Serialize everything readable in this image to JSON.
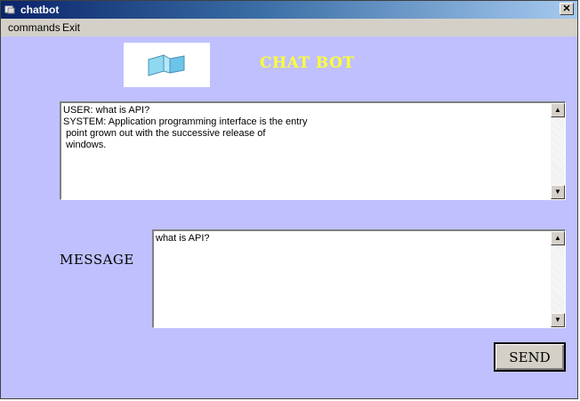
{
  "window": {
    "title": "chatbot",
    "close_glyph": "✕"
  },
  "menu": {
    "items": [
      "commands",
      "Exit"
    ]
  },
  "header": {
    "title": "CHAT BOT",
    "logo_icon": "chat-bubbles-icon"
  },
  "conversation": {
    "text": "USER: what is API?\nSYSTEM: Application programming interface is the entry\n point grown out with the successive release of\n windows."
  },
  "message": {
    "label": "MESSAGE",
    "value": "what is API?"
  },
  "send": {
    "label": "SEND"
  },
  "scroll": {
    "up": "▲",
    "down": "▼"
  },
  "colors": {
    "client_bg": "#c0c0ff",
    "heading": "#ffff33",
    "titlebar": "#0a246a"
  }
}
